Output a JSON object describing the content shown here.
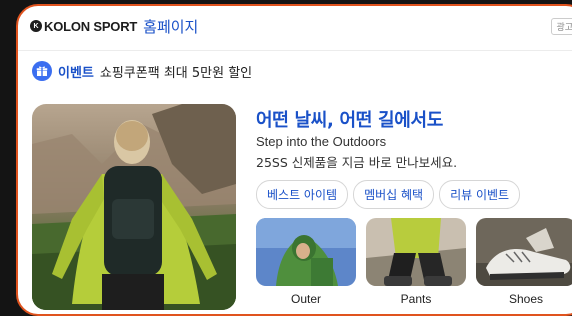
{
  "header": {
    "brand_badge": "K",
    "brand_name": "KOLON SPORT",
    "home_link": "홈페이지",
    "ad_badge": "광고"
  },
  "event": {
    "label": "이벤트",
    "text": "쇼핑쿠폰팩 최대 5만원 할인"
  },
  "promo": {
    "headline": "어떤 날씨, 어떤 길에서도",
    "subtitle_en": "Step into the Outdoors",
    "subtitle_ko": "25SS 신제품을 지금 바로 만나보세요."
  },
  "chips": [
    "베스트 아이템",
    "멤버십 혜택",
    "리뷰 이벤트"
  ],
  "thumbnails": [
    {
      "label": "Outer"
    },
    {
      "label": "Pants"
    },
    {
      "label": "Shoes"
    }
  ],
  "colors": {
    "accent_blue": "#1a51c8",
    "border_orange": "#e0531e",
    "jacket_green": "#b5cd3a"
  }
}
